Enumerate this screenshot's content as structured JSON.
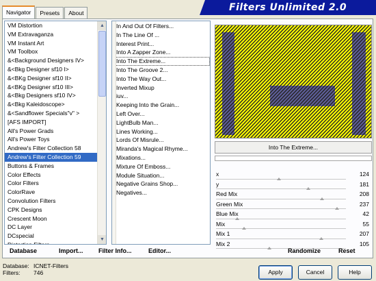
{
  "tabs": [
    "Navigator",
    "Presets",
    "About"
  ],
  "banner": "Filters Unlimited 2.0",
  "categories": [
    "VM Distortion",
    "VM Extravaganza",
    "VM Instant Art",
    "VM Toolbox",
    "&<Background Designers IV>",
    "&<Bkg Designer sf10 I>",
    "&<BKg Designer sf10 II>",
    "&<BKg Designer sf10 III>",
    "&<Bkg Designers sf10 IV>",
    "&<Bkg Kaleidoscope>",
    "&<Sandflower Specials\"v\" >",
    "[AFS IMPORT]",
    "All's Power Grads",
    "All's Power Toys",
    "Andrew's Filter Collection 58",
    "Andrew's Filter Collection 59",
    "Buttons & Frames",
    "Color Effects",
    "Color Filters",
    "ColorRave",
    "Convolution Filters",
    "CPK Designs",
    "Crescent Moon",
    "DC Layer",
    "DCspecial",
    "Distortion Filters"
  ],
  "selected_category": "Andrew's Filter Collection 59",
  "filters": [
    "In And Out Of Filters...",
    "In The Line Of ...",
    "Interest Print...",
    "Into A Zapper Zone...",
    "Into The Extreme...",
    "Into The Groove 2...",
    "Into The Way Out...",
    "Inverted Mixup",
    "iuv...",
    "Keeping Into the Grain...",
    "Left Over...",
    "LightBulb Man...",
    "Lines Working...",
    "Lords Of Misrule...",
    "Miranda's Magical Rhyme...",
    "Mixations...",
    "Mixture Of Emboss...",
    "Module Situation...",
    "Negative Grains Shop...",
    "Negatives..."
  ],
  "selected_filter": "Into The Extreme...",
  "preview": {
    "bg": "#ffff00",
    "line": "#222222",
    "accent": "#2a2acc"
  },
  "params": [
    {
      "label": "x",
      "value": 124
    },
    {
      "label": "y",
      "value": 181
    },
    {
      "label": "Red Mix",
      "value": 208
    },
    {
      "label": "Green Mix",
      "value": 237
    },
    {
      "label": "Blue Mix",
      "value": 42
    },
    {
      "label": "Mix",
      "value": 55
    },
    {
      "label": "Mix 1",
      "value": 207
    },
    {
      "label": "Mix 2",
      "value": 105
    }
  ],
  "bottom": {
    "database": "Database",
    "import": "Import...",
    "filter_info": "Filter Info...",
    "editor": "Editor...",
    "randomize": "Randomize",
    "reset": "Reset"
  },
  "status": {
    "database_label": "Database:",
    "database_value": "ICNET-Filters",
    "filters_label": "Filters:",
    "filters_value": "746"
  },
  "buttons": {
    "apply": "Apply",
    "cancel": "Cancel",
    "help": "Help"
  }
}
